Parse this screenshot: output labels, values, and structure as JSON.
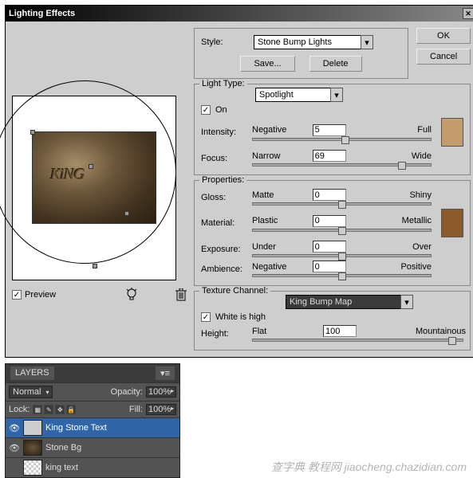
{
  "title": "Lighting Effects",
  "buttons": {
    "ok": "OK",
    "cancel": "Cancel",
    "save": "Save...",
    "delete": "Delete"
  },
  "style": {
    "label": "Style:",
    "value": "Stone Bump Lights"
  },
  "light": {
    "groupLabel": "Light Type:",
    "value": "Spotlight",
    "onLabel": "On",
    "onChecked": "✓",
    "intensity": {
      "label": "Intensity:",
      "left": "Negative",
      "right": "Full",
      "value": "5",
      "pos": 52
    },
    "focus": {
      "label": "Focus:",
      "left": "Narrow",
      "right": "Wide",
      "value": "69",
      "pos": 84
    }
  },
  "props": {
    "groupLabel": "Properties:",
    "gloss": {
      "label": "Gloss:",
      "left": "Matte",
      "right": "Shiny",
      "value": "0",
      "pos": 50
    },
    "material": {
      "label": "Material:",
      "left": "Plastic",
      "right": "Metallic",
      "value": "0",
      "pos": 50
    },
    "exposure": {
      "label": "Exposure:",
      "left": "Under",
      "right": "Over",
      "value": "0",
      "pos": 50
    },
    "ambience": {
      "label": "Ambience:",
      "left": "Negative",
      "right": "Positive",
      "value": "0",
      "pos": 50
    }
  },
  "texture": {
    "groupLabel": "Texture Channel:",
    "value": "King Bump Map",
    "whiteLabel": "White is high",
    "whiteChecked": "✓",
    "height": {
      "label": "Height:",
      "left": "Flat",
      "right": "Mountainous",
      "value": "100",
      "pos": 95
    }
  },
  "preview": {
    "label": "Preview",
    "checked": "✓",
    "text": "KiNG"
  },
  "layers": {
    "tab": "LAYERS",
    "mode": "Normal",
    "opacityLabel": "Opacity:",
    "opacity": "100%",
    "lockLabel": "Lock:",
    "fillLabel": "Fill:",
    "fill": "100%",
    "items": [
      {
        "name": "King Stone Text"
      },
      {
        "name": "Stone Bg"
      },
      {
        "name": "king text"
      }
    ]
  },
  "watermark": "查字典 教程网 jiaocheng.chazidian.com"
}
